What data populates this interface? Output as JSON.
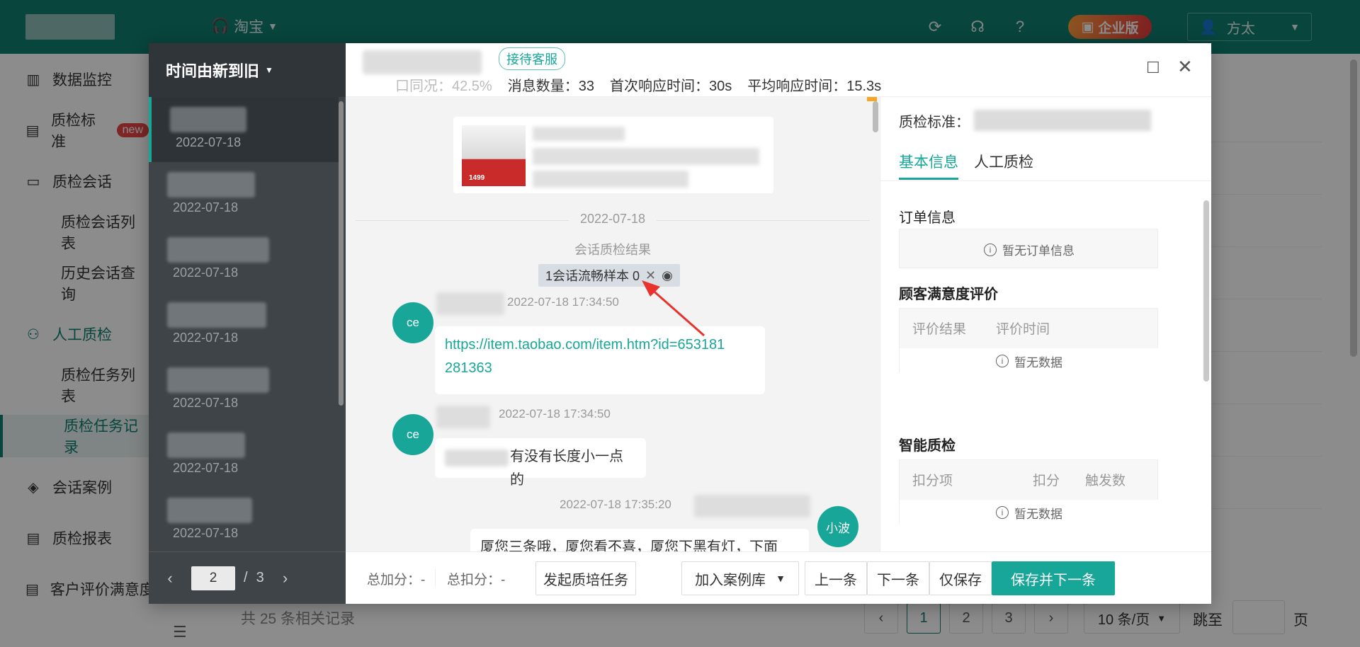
{
  "app": {
    "platform": "淘宝",
    "enterprise_badge": "企业版",
    "user_name": "方太",
    "icons": [
      "headset-icon",
      "refresh-icon",
      "service-icon",
      "help-icon",
      "user-icon"
    ]
  },
  "sidebar": {
    "items": [
      {
        "label": "数据监控",
        "icon": "chart-icon"
      },
      {
        "label": "质检标准",
        "badge": "new",
        "icon": "document-icon"
      },
      {
        "label": "质检会话",
        "icon": "chat-icon"
      },
      {
        "label": "质检会话列表"
      },
      {
        "label": "历史会话查询"
      },
      {
        "label": "人工质检",
        "icon": "person-icon"
      },
      {
        "label": "质检任务列表"
      },
      {
        "label": "质检任务记录"
      },
      {
        "label": "会话案例",
        "icon": "layers-icon"
      },
      {
        "label": "质检报表",
        "icon": "report-icon"
      },
      {
        "label": "客户评价满意度",
        "icon": "report-icon"
      }
    ]
  },
  "background_table": {
    "records_text": "共 25 条相关记录",
    "pages": [
      "1",
      "2",
      "3"
    ],
    "current_page": "1",
    "page_size": "10 条/页",
    "jump_label": "跳至",
    "page_unit": "页"
  },
  "modal": {
    "list": {
      "sort_label": "时间由新到旧",
      "dates": [
        "2022-07-18",
        "2022-07-18",
        "2022-07-18",
        "2022-07-18",
        "2022-07-18",
        "2022-07-18",
        "2022-07-18"
      ],
      "pager": {
        "current": "2",
        "separator": "/",
        "total": "3"
      }
    },
    "header": {
      "service_tag": "接待客服",
      "stats": [
        "口同况：42.5%",
        "消息数量：33",
        "首次响应时间：30s",
        "平均响应时间：15.3s"
      ]
    },
    "chat": {
      "product_price": "1499",
      "date_divider": "2022-07-18",
      "qc_result_label": "会话质检结果",
      "qc_tag": "1会话流畅样本 0",
      "messages": [
        {
          "avatar": "ce",
          "time": "2022-07-18 17:34:50",
          "lines": [
            "https://item.taobao.com/item.htm?id=653181",
            "281363"
          ]
        },
        {
          "avatar": "ce",
          "time": "2022-07-18 17:34:50",
          "text": "有没有长度小一点的"
        },
        {
          "avatar": "小波",
          "time": "2022-07-18 17:35:20",
          "text": "厦您三条哦，厦您看不喜，厦您下黑有灯，下面"
        }
      ]
    },
    "qc_panel": {
      "standard_label": "质检标准：",
      "tabs": [
        "基本信息",
        "人工质检"
      ],
      "order_title": "订单信息",
      "order_empty": "暂无订单信息",
      "satisfaction_title": "顾客满意度评价",
      "satisfaction_headers": [
        "评价结果",
        "评价时间"
      ],
      "empty": "暂无数据",
      "smart_title": "智能质检",
      "smart_headers": [
        "扣分项",
        "扣分",
        "触发数"
      ]
    },
    "footer": {
      "total_add": "总加分：-",
      "total_deduct": "总扣分：-",
      "training_button": "发起质培任务",
      "case_library": "加入案例库",
      "prev": "上一条",
      "next": "下一条",
      "save_only": "仅保存",
      "save_next": "保存并下一条"
    }
  },
  "colors": {
    "brand": "#0f7f6f",
    "accent": "#17a698",
    "annotation_arrow": "#e8322b"
  }
}
